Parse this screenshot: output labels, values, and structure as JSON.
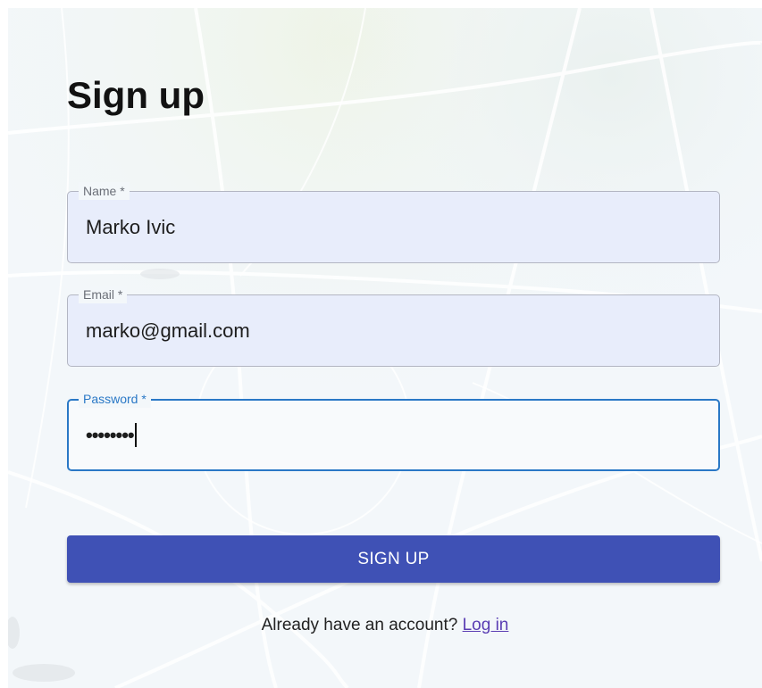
{
  "page": {
    "title": "Sign up"
  },
  "form": {
    "name": {
      "label": "Name *",
      "value": "Marko Ivic"
    },
    "email": {
      "label": "Email *",
      "value": "marko@gmail.com"
    },
    "password": {
      "label": "Password *",
      "value": "••••••••"
    },
    "submit_label": "SIGN UP"
  },
  "footer": {
    "prompt": "Already have an account?",
    "link_label": "Log in"
  },
  "colors": {
    "primary": "#3f51b5",
    "focus": "#2a78c6",
    "input_fill": "#e8edfb",
    "link": "#5a3db3"
  }
}
